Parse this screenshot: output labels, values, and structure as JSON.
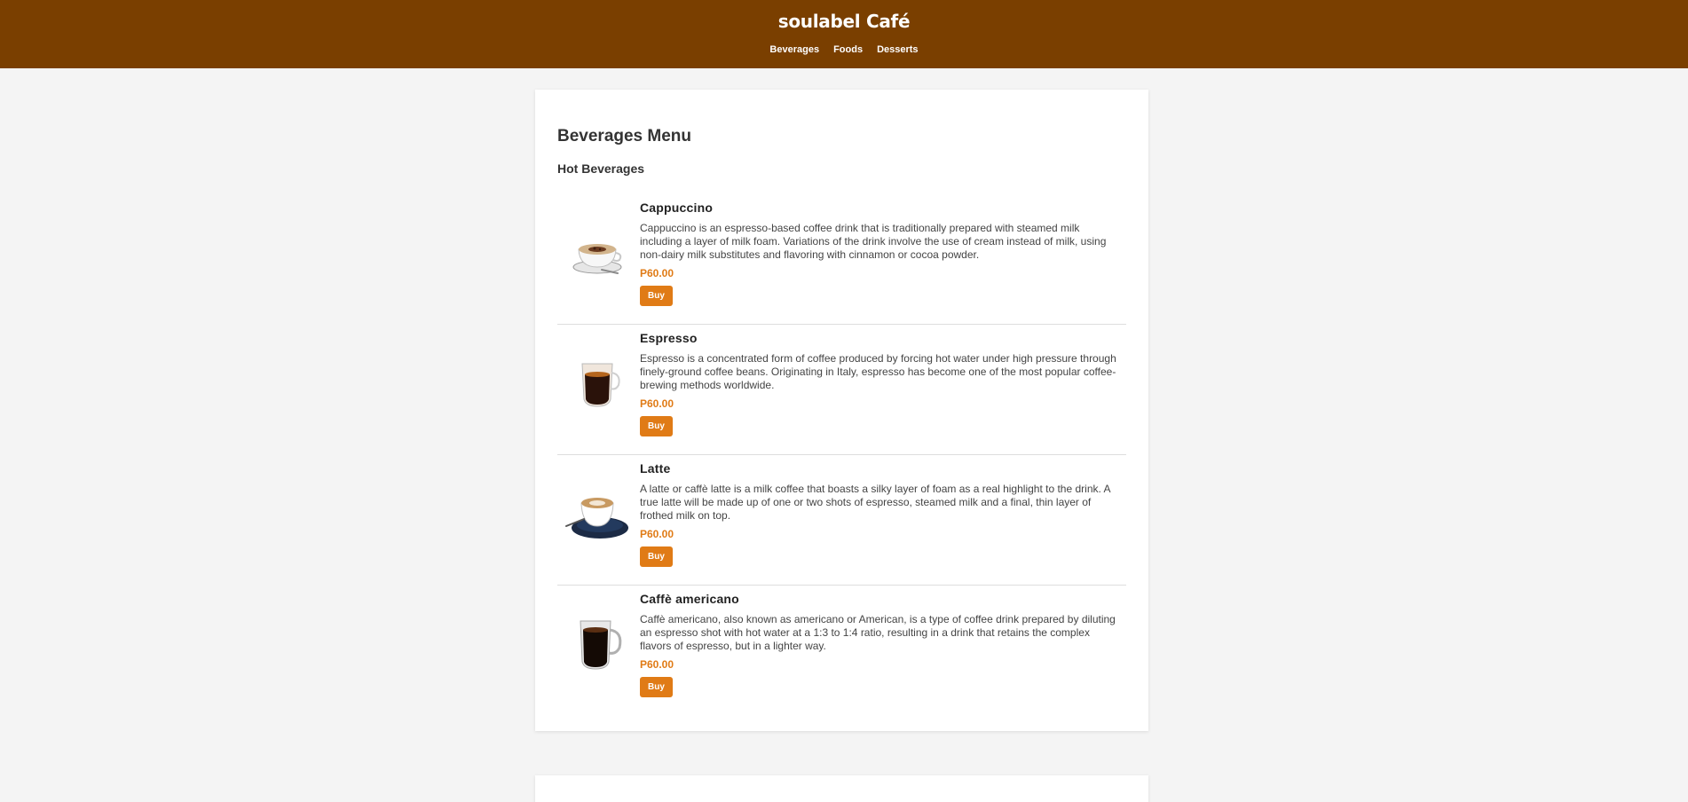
{
  "header": {
    "brand": "soulabel Café",
    "nav": [
      "Beverages",
      "Foods",
      "Desserts"
    ],
    "background_color": "#7a3f00"
  },
  "menu": {
    "title": "Beverages Menu",
    "section": "Hot Beverages",
    "items": [
      {
        "name": "Cappuccino",
        "description": "Cappuccino is an espresso-based coffee drink that is traditionally prepared with steamed milk including a layer of milk foam. Variations of the drink involve the use of cream instead of milk, using non-dairy milk substitutes and flavoring with cinnamon or cocoa powder.",
        "price": "P60.00",
        "button": "Buy",
        "image": "cappuccino-cup-image"
      },
      {
        "name": "Espresso",
        "description": "Espresso is a concentrated form of coffee produced by forcing hot water under high pressure through finely-ground coffee beans. Originating in Italy, espresso has become one of the most popular coffee-brewing methods worldwide.",
        "price": "P60.00",
        "button": "Buy",
        "image": "espresso-glass-image"
      },
      {
        "name": "Latte",
        "description": "A latte or caffè latte is a milk coffee that boasts a silky layer of foam as a real highlight to the drink. A true latte will be made up of one or two shots of espresso, steamed milk and a final, thin layer of frothed milk on top.",
        "price": "P60.00",
        "button": "Buy",
        "image": "latte-cup-image"
      },
      {
        "name": "Caffè americano",
        "description": "Caffè americano, also known as americano or American, is a type of coffee drink prepared by diluting an espresso shot with hot water at a 1:3 to 1:4 ratio, resulting in a drink that retains the complex flavors of espresso, but in a lighter way.",
        "price": "P60.00",
        "button": "Buy",
        "image": "americano-mug-image"
      }
    ]
  },
  "colors": {
    "accent": "#e07b16",
    "page_background": "#f4f4f4"
  }
}
